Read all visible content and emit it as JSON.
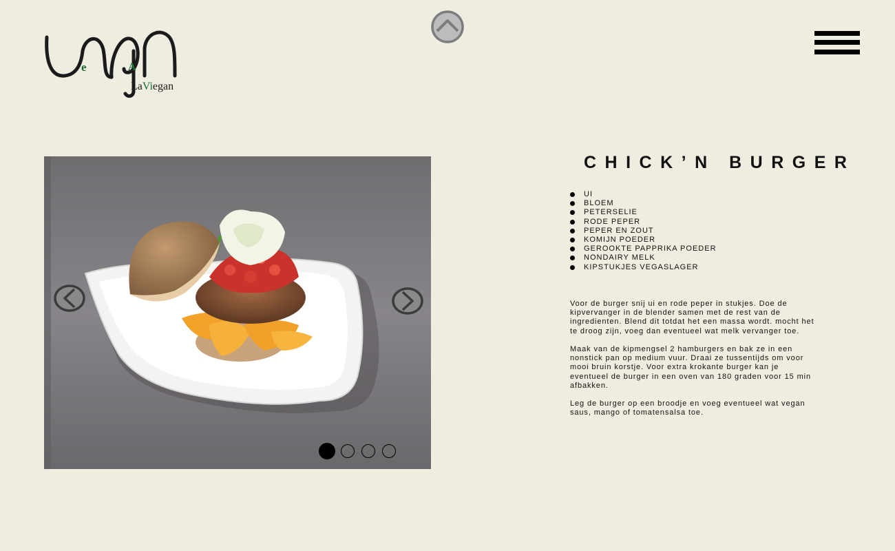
{
  "brand": {
    "logo_text": "LaViegan",
    "logo_part_1": "La",
    "logo_part_2": "Vi",
    "logo_part_3": "egan",
    "wordmark": "vegan",
    "colors": {
      "dark": "#1b1b1b",
      "green": "#1c6b34",
      "background": "#efece0"
    }
  },
  "header": {
    "scroll_up_icon": "chevron-up-circle-icon",
    "menu_icon": "hamburger-menu-icon"
  },
  "slider": {
    "prev_icon": "chevron-left-circle-icon",
    "next_icon": "chevron-right-circle-icon",
    "slide_count": 4,
    "active_slide": 1,
    "image": "vegan burger on white square plate with mango and tomato salsa"
  },
  "recipe": {
    "title": "CHICK’N BURGER",
    "ingredients": [
      "UI",
      "BLOEM",
      "PETERSELIE",
      "RODE PEPER",
      "PEPER EN ZOUT",
      "KOMIJN POEDER",
      "GEROOKTE PAPPRIKA POEDER",
      "NONDAIRY MELK",
      "KIPSTUKJES VEGASLAGER"
    ],
    "instructions": [
      "Voor de burger snij ui en rode peper in stukjes. Doe de kipvervanger in de blender samen met de rest van de ingredienten. Blend dit totdat het een massa wordt. mocht het te droog zijn, voeg dan eventueel wat melk vervanger toe.",
      "Maak van de kipmengsel 2 hamburgers en bak ze in een nonstick pan op medium vuur. Draai ze tussentijds om voor mooi bruin korstje. Voor extra krokante burger kan je eventueel de burger in een oven van 180 graden voor 15 min afbakken.",
      "Leg de burger op een broodje en voeg eventueel wat vegan saus, mango of tomatensalsa toe."
    ]
  }
}
